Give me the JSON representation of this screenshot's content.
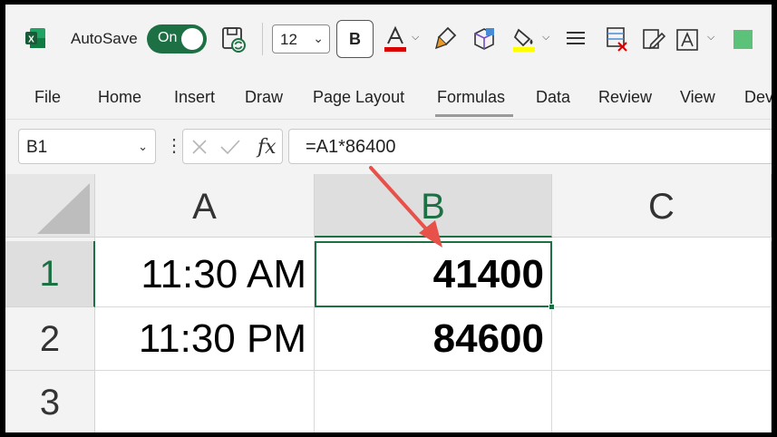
{
  "toolbar": {
    "autosave_label": "AutoSave",
    "autosave_state": "On",
    "font_size": "12",
    "bold_label": "B"
  },
  "tabs": [
    "File",
    "Home",
    "Insert",
    "Draw",
    "Page Layout",
    "Formulas",
    "Data",
    "Review",
    "View",
    "Dev"
  ],
  "active_tab": "Formulas",
  "formula_bar": {
    "name_box": "B1",
    "formula": "=A1*86400"
  },
  "sheet": {
    "columns": [
      "A",
      "B",
      "C"
    ],
    "rows": [
      "1",
      "2",
      "3"
    ],
    "cells": {
      "A1": "11:30 AM",
      "B1": "41400",
      "A2": "11:30 PM",
      "B2": "84600"
    },
    "selected_cell": "B1"
  },
  "colors": {
    "accent": "#1d7044",
    "arrow": "#e8504a",
    "font_color_bar": "#d90000",
    "highlight_bar": "#ffff00",
    "fill_swatch": "#5cc27a"
  }
}
